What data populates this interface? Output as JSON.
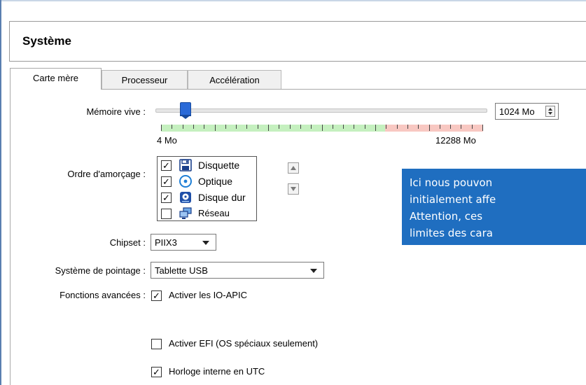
{
  "section_title": "Système",
  "tabs": [
    {
      "label": "Carte mère",
      "active": true
    },
    {
      "label": "Processeur",
      "active": false
    },
    {
      "label": "Accélération",
      "active": false
    }
  ],
  "memory": {
    "label": "Mémoire vive :",
    "min_label": "4 Mo",
    "max_label": "12288 Mo",
    "value": "1024 Mo",
    "slider_value_mo": 1024,
    "slider_min_mo": 4,
    "slider_max_mo": 12288
  },
  "boot_order": {
    "label": "Ordre d'amorçage :",
    "items": [
      {
        "label": "Disquette",
        "checked": true,
        "icon": "floppy-icon"
      },
      {
        "label": "Optique",
        "checked": true,
        "icon": "optical-disc-icon"
      },
      {
        "label": "Disque dur",
        "checked": true,
        "icon": "hard-disk-icon"
      },
      {
        "label": "Réseau",
        "checked": false,
        "icon": "network-icon"
      }
    ]
  },
  "chipset": {
    "label": "Chipset :",
    "value": "PIIX3"
  },
  "pointing": {
    "label": "Système de pointage :",
    "value": "Tablette USB"
  },
  "advanced": {
    "label": "Fonctions avancées :",
    "options": [
      {
        "label": "Activer les IO-APIC",
        "checked": true
      },
      {
        "label": "Activer EFI (OS spéciaux seulement)",
        "checked": false
      },
      {
        "label": "Horloge interne en UTC",
        "checked": true
      }
    ]
  },
  "tooltip": {
    "lines": [
      "Ici nous pouvon",
      "initialement affe",
      "Attention,  ces",
      "limites des cara"
    ]
  },
  "colors": {
    "accent": "#1f6ec0",
    "slider_thumb": "#2a6ad8",
    "ok_zone": "#c5f0bf",
    "warn_zone": "#f8c8c2"
  }
}
